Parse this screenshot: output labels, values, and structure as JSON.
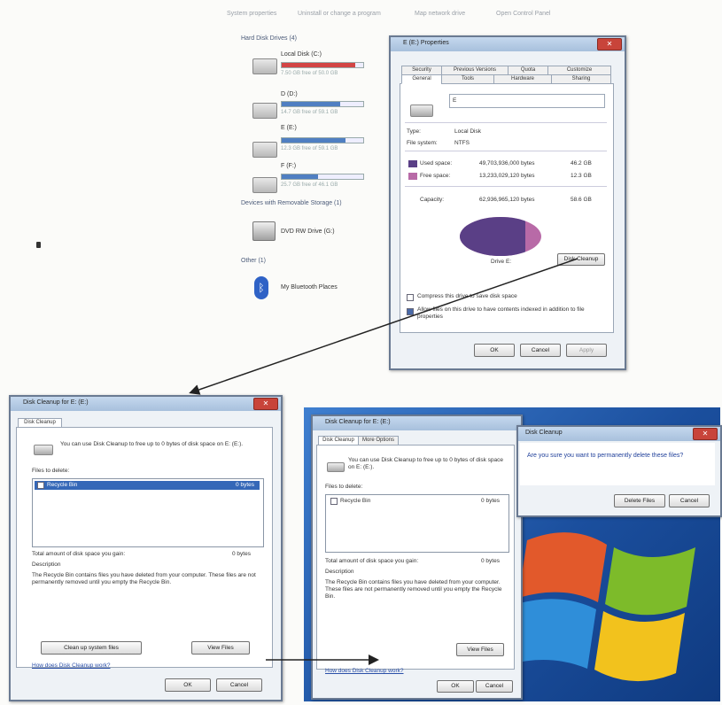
{
  "colors": {
    "used": "#5a3f86",
    "free": "#b86aa7",
    "bar_red": "#d24545",
    "bar_blue": "#4f7fc2",
    "titlebar": "#b8cde6",
    "close": "#c8443a",
    "desktop": "#1b4f9e"
  },
  "toolbar": {
    "items": [
      "System properties",
      "Uninstall or change a program",
      "Map network drive",
      "Open Control Panel"
    ]
  },
  "explorer": {
    "group_hard_disk": "Hard Disk Drives (4)",
    "group_removable": "Devices with Removable Storage (1)",
    "group_other": "Other (1)",
    "drives": [
      {
        "name": "Local Disk (C:)",
        "free": "7.50 GB free of 50.0 GB",
        "usage": 0.9,
        "bar": "red"
      },
      {
        "name": "D (D:)",
        "free": "14.7 GB free of 59.1 GB",
        "usage": 0.72,
        "bar": "blue"
      },
      {
        "name": "E (E:)",
        "free": "12.3 GB free of 59.1 GB",
        "usage": 0.78,
        "bar": "blue"
      },
      {
        "name": "F (F:)",
        "free": "25.7 GB free of 46.1 GB",
        "usage": 0.45,
        "bar": "blue"
      }
    ],
    "dvd_label": "DVD RW Drive (G:)",
    "bluetooth_label": "My Bluetooth Places",
    "icons": [
      "drive-icon",
      "dvd-icon",
      "bluetooth-icon"
    ]
  },
  "properties_window": {
    "title": "E (E:) Properties",
    "tabs_top": [
      "Security",
      "Previous Versions",
      "Quota",
      "Customize"
    ],
    "tabs_bottom": [
      "General",
      "Tools",
      "Hardware",
      "Sharing"
    ],
    "drive_label": "E",
    "type_label": "Type:",
    "type_value": "Local Disk",
    "fs_label": "File system:",
    "fs_value": "NTFS",
    "used_label": "Used space:",
    "used_bytes": "49,703,936,000 bytes",
    "used_gb": "46.2 GB",
    "free_label": "Free space:",
    "free_bytes": "13,233,029,120 bytes",
    "free_gb": "12.3 GB",
    "capacity_label": "Capacity:",
    "capacity_bytes": "62,936,965,120 bytes",
    "capacity_gb": "58.6 GB",
    "drive_name": "Drive E:",
    "disk_cleanup_btn": "Disk Cleanup",
    "compress_label": "Compress this drive to save disk space",
    "index_label": "Allow files on this drive to have contents indexed in addition to file properties",
    "ok": "OK",
    "cancel": "Cancel",
    "apply": "Apply",
    "used_fraction": 0.79
  },
  "cleanup_window": {
    "title": "Disk Cleanup for E: (E:)",
    "tab": "Disk Cleanup",
    "intro": "You can use Disk Cleanup to free up to 0 bytes of disk space on E: (E:).",
    "files_label": "Files to delete:",
    "item": "Recycle Bin",
    "item_size": "0 bytes",
    "total_label": "Total amount of disk space you gain:",
    "total_value": "0 bytes",
    "desc_label": "Description",
    "desc_text": "The Recycle Bin contains files you have deleted from your computer. These files are not permanently removed until you empty the Recycle Bin.",
    "clean_system_btn": "Clean up system files",
    "view_files_btn": "View Files",
    "link": "How does Disk Cleanup work?",
    "ok": "OK",
    "cancel": "Cancel"
  },
  "cleanup_window_2": {
    "title": "Disk Cleanup for E: (E:)",
    "tabs": [
      "Disk Cleanup",
      "More Options"
    ],
    "intro": "You can use Disk Cleanup to free up to 0 bytes of disk space on E: (E:).",
    "files_label": "Files to delete:",
    "item": "Recycle Bin",
    "item_size": "0 bytes",
    "total_label": "Total amount of disk space you gain:",
    "total_value": "0 bytes",
    "desc_label": "Description",
    "desc_text": "The Recycle Bin contains files you have deleted from your computer. These files are not permanently removed until you empty the Recycle Bin.",
    "view_files_btn": "View Files",
    "link": "How does Disk Cleanup work?",
    "ok": "OK",
    "cancel": "Cancel"
  },
  "confirm_dialog": {
    "title": "Disk Cleanup",
    "message": "Are you sure you want to permanently delete these files?",
    "delete_btn": "Delete Files",
    "cancel_btn": "Cancel"
  }
}
